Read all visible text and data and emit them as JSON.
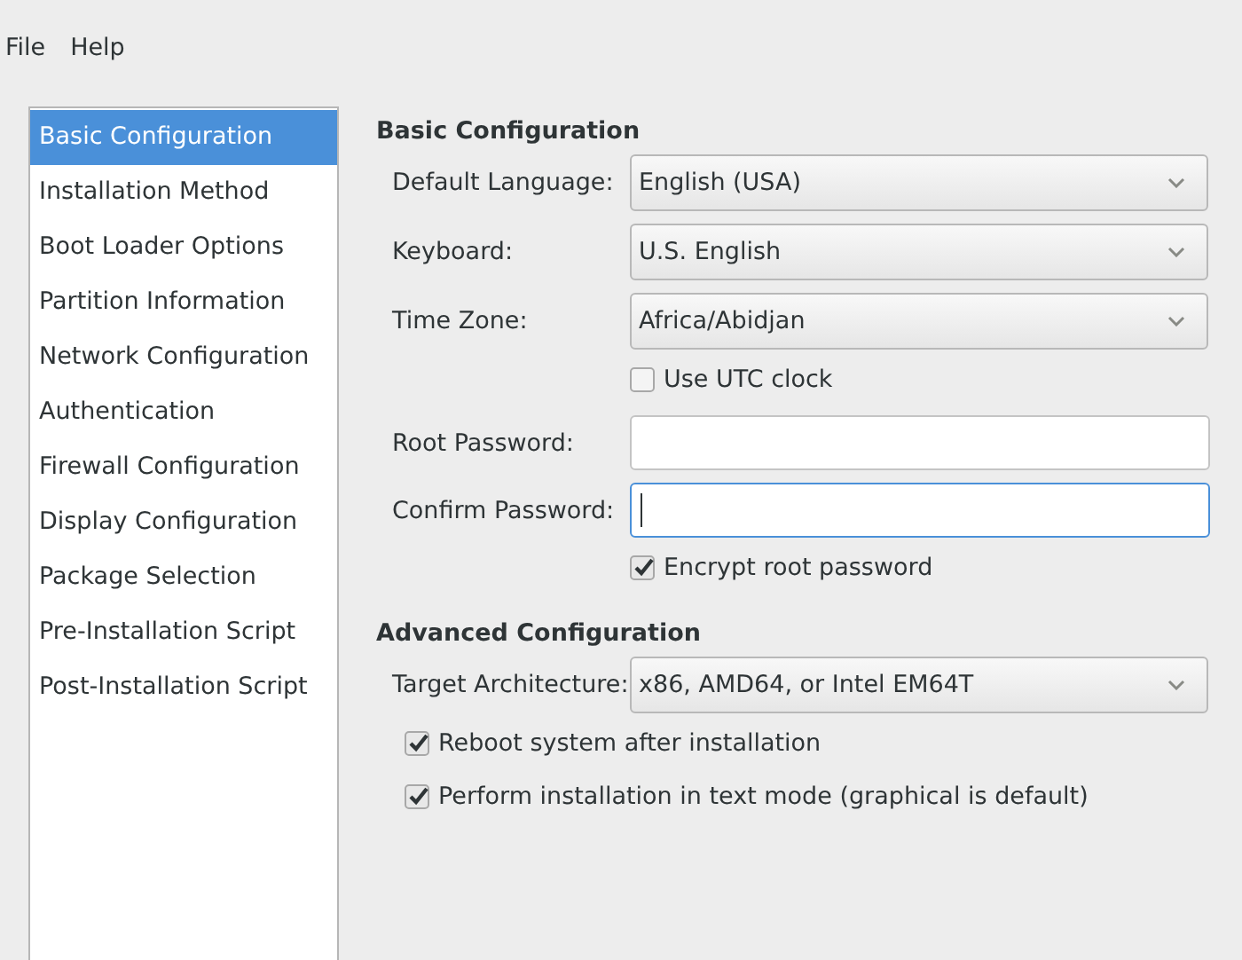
{
  "menu": [
    {
      "label": "File"
    },
    {
      "label": "Help"
    }
  ],
  "sidebar": {
    "items": [
      {
        "label": "Basic Configuration",
        "selected": true
      },
      {
        "label": "Installation Method",
        "selected": false
      },
      {
        "label": "Boot Loader Options",
        "selected": false
      },
      {
        "label": "Partition Information",
        "selected": false
      },
      {
        "label": "Network Configuration",
        "selected": false
      },
      {
        "label": "Authentication",
        "selected": false
      },
      {
        "label": "Firewall Configuration",
        "selected": false
      },
      {
        "label": "Display Configuration",
        "selected": false
      },
      {
        "label": "Package Selection",
        "selected": false
      },
      {
        "label": "Pre-Installation Script",
        "selected": false
      },
      {
        "label": "Post-Installation Script",
        "selected": false
      }
    ]
  },
  "sections": [
    {
      "title": "Basic Configuration",
      "fields": [
        {
          "kind": "dropdown",
          "label": "Default Language:",
          "value": "English (USA)"
        },
        {
          "kind": "dropdown",
          "label": "Keyboard:",
          "value": "U.S. English"
        },
        {
          "kind": "dropdown",
          "label": "Time Zone:",
          "value": "Africa/Abidjan"
        },
        {
          "kind": "checkbox",
          "label": "Use UTC clock",
          "checked": false
        },
        {
          "kind": "password",
          "label": "Root Password:",
          "focused": false
        },
        {
          "kind": "password",
          "label": "Confirm Password:",
          "focused": true
        },
        {
          "kind": "checkbox",
          "label": "Encrypt root password",
          "checked": true
        }
      ]
    },
    {
      "title": "Advanced Configuration",
      "fields": [
        {
          "kind": "dropdown",
          "label": "Target Architecture:",
          "value": "x86, AMD64, or Intel EM64T"
        },
        {
          "kind": "option",
          "label": "Reboot system after installation",
          "checked": true
        },
        {
          "kind": "option",
          "label": "Perform installation in text mode (graphical is default)",
          "checked": true
        }
      ]
    }
  ]
}
